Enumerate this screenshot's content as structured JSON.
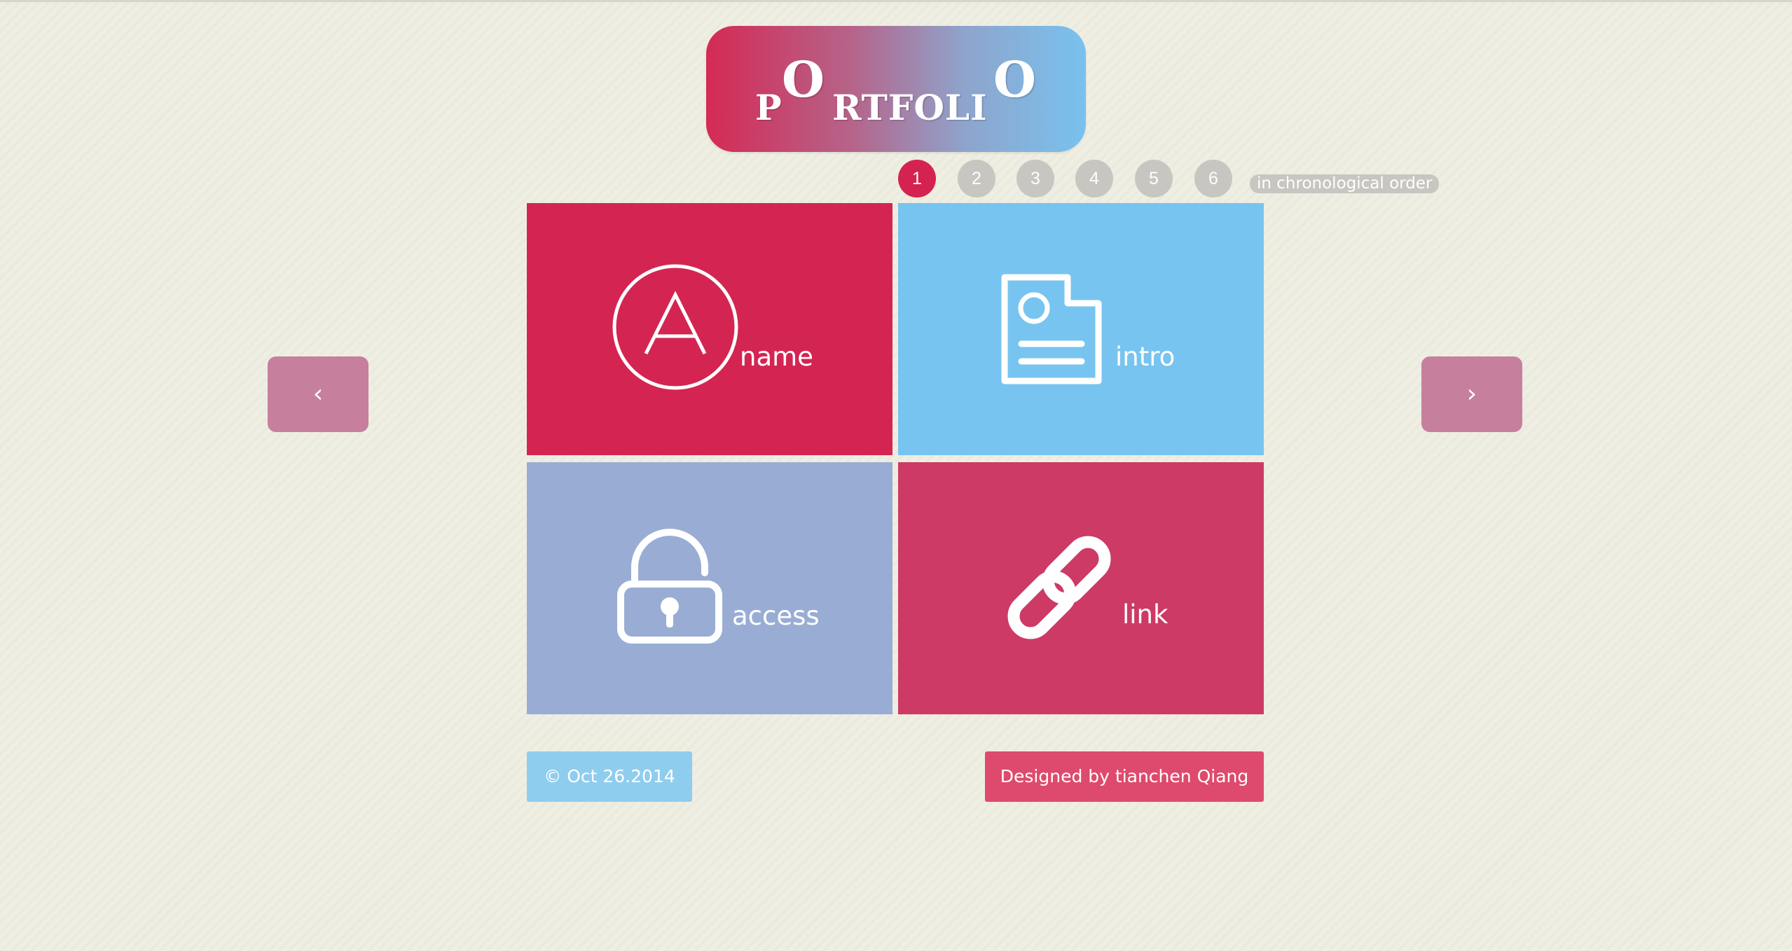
{
  "logo": {
    "letter_p": "P",
    "letter_o1": "O",
    "letters_rtfoli": "RTFOLI",
    "letter_o2": "O"
  },
  "pagination": {
    "pages": [
      "1",
      "2",
      "3",
      "4",
      "5",
      "6"
    ],
    "active_page": "1",
    "order_label": "in chronological order"
  },
  "navigation": {
    "prev_glyph": "‹",
    "next_glyph": "›"
  },
  "tiles": [
    {
      "label": "name",
      "icon": "letter-a-circle-icon",
      "color": "#d42552"
    },
    {
      "label": "intro",
      "icon": "document-profile-icon",
      "color": "#78c4f0"
    },
    {
      "label": "access",
      "icon": "padlock-icon",
      "color": "#99add4"
    },
    {
      "label": "link",
      "icon": "chain-link-icon",
      "color": "#cd3a65"
    }
  ],
  "footer": {
    "date": "© Oct 26.2014",
    "designer": "Designed by tianchen Qiang"
  },
  "colors": {
    "background": "#efeee2",
    "accent_red": "#d42350",
    "accent_blue": "#78c4f0",
    "arrow": "#c6809e",
    "inactive_dot": "#c8c6c1"
  }
}
